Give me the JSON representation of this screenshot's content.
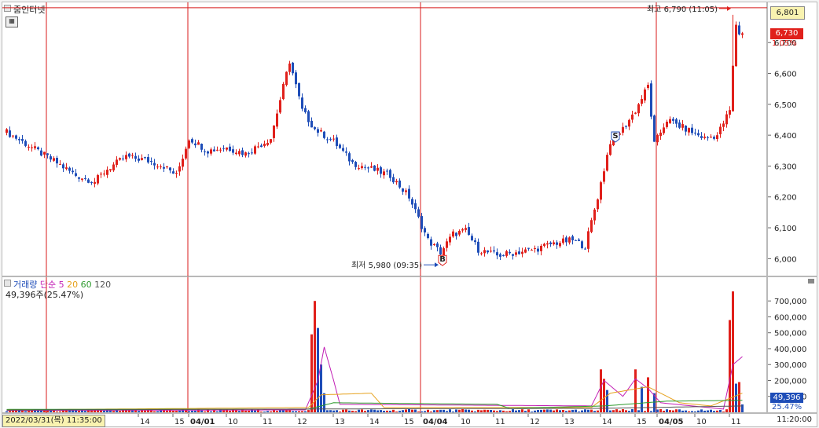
{
  "title": "줌인터넷",
  "price_current_label": "6,730",
  "price_change_label": "1.05%",
  "price_axis_top_label": "6,801",
  "price_high_annotation": "최고 6,790 (11:05)",
  "price_low_annotation": "최저 5,980 (09:35)",
  "signal_buy_label": "B",
  "signal_sell_label": "S",
  "volume_header": {
    "name": "거래량",
    "ma_label": "단순",
    "ma_periods": [
      "5",
      "20",
      "60",
      "120"
    ],
    "current_text": "49,396주(25.47%)"
  },
  "volume_current_label": "49,396",
  "volume_current_pct": "25.47%",
  "crosshair_time_label": "2022/03/31(목) 11:35:00",
  "time_axis_right_label": "11:20:00",
  "colors": {
    "up": "#e0201b",
    "down": "#1e4db8",
    "ma5": "#c21fb5",
    "ma20": "#e6a11c",
    "ma60": "#2d9a2d",
    "ma120": "#555555",
    "session_line": "#d81b1b"
  },
  "chart_data": [
    {
      "type": "candlestick",
      "title": "줌인터넷",
      "y_ticks": [
        "6,700",
        "6,600",
        "6,500",
        "6,400",
        "6,300",
        "6,200",
        "6,100",
        "6,000"
      ],
      "ylim": [
        5950,
        6810
      ],
      "x_tick_labels": [
        "14",
        "15",
        "04/01",
        "10",
        "11",
        "12",
        "13",
        "14",
        "15",
        "04/04",
        "10",
        "11",
        "12",
        "13",
        "14",
        "15",
        "04/05",
        "10",
        "11"
      ],
      "session_breaks": [
        "03/31 15:00",
        "04/01",
        "04/04",
        "04/05"
      ],
      "close_path": [
        [
          0,
          6410
        ],
        [
          8,
          6360
        ],
        [
          16,
          6310
        ],
        [
          22,
          6270
        ],
        [
          28,
          6250
        ],
        [
          32,
          6290
        ],
        [
          38,
          6330
        ],
        [
          44,
          6320
        ],
        [
          50,
          6300
        ],
        [
          54,
          6270
        ],
        [
          58,
          6390
        ],
        [
          64,
          6350
        ],
        [
          70,
          6360
        ],
        [
          76,
          6340
        ],
        [
          84,
          6390
        ],
        [
          90,
          6640
        ],
        [
          94,
          6480
        ],
        [
          98,
          6420
        ],
        [
          104,
          6380
        ],
        [
          110,
          6310
        ],
        [
          116,
          6290
        ],
        [
          122,
          6270
        ],
        [
          128,
          6200
        ],
        [
          134,
          6060
        ],
        [
          138,
          6020
        ],
        [
          142,
          6080
        ],
        [
          146,
          6090
        ],
        [
          150,
          6030
        ],
        [
          156,
          6010
        ],
        [
          162,
          6020
        ],
        [
          168,
          6030
        ],
        [
          174,
          6050
        ],
        [
          180,
          6060
        ],
        [
          184,
          6040
        ],
        [
          188,
          6200
        ],
        [
          192,
          6380
        ],
        [
          196,
          6420
        ],
        [
          200,
          6480
        ],
        [
          204,
          6560
        ],
        [
          206,
          6370
        ],
        [
          210,
          6450
        ],
        [
          216,
          6420
        ],
        [
          222,
          6390
        ],
        [
          226,
          6400
        ],
        [
          230,
          6480
        ],
        [
          232,
          6760
        ],
        [
          234,
          6700
        ]
      ],
      "high": 6790,
      "low": 5980,
      "last": 6730,
      "signals": [
        {
          "type": "B",
          "price": 5980
        },
        {
          "type": "S",
          "price": 6380
        }
      ]
    },
    {
      "type": "bar",
      "title": "거래량",
      "y_ticks": [
        "700,000",
        "600,000",
        "500,000",
        "400,000",
        "300,000",
        "200,000",
        "100,000"
      ],
      "ylim": [
        0,
        780000
      ],
      "spikes": [
        {
          "bar": 97,
          "value": 490000,
          "dir": "up"
        },
        {
          "bar": 98,
          "value": 700000,
          "dir": "up"
        },
        {
          "bar": 99,
          "value": 530000,
          "dir": "down"
        },
        {
          "bar": 100,
          "value": 300000,
          "dir": "down"
        },
        {
          "bar": 101,
          "value": 120000,
          "dir": "down"
        },
        {
          "bar": 189,
          "value": 270000,
          "dir": "up"
        },
        {
          "bar": 190,
          "value": 210000,
          "dir": "up"
        },
        {
          "bar": 191,
          "value": 140000,
          "dir": "down"
        },
        {
          "bar": 200,
          "value": 270000,
          "dir": "up"
        },
        {
          "bar": 202,
          "value": 160000,
          "dir": "down"
        },
        {
          "bar": 204,
          "value": 220000,
          "dir": "up"
        },
        {
          "bar": 206,
          "value": 120000,
          "dir": "down"
        },
        {
          "bar": 230,
          "value": 580000,
          "dir": "up"
        },
        {
          "bar": 231,
          "value": 760000,
          "dir": "up"
        },
        {
          "bar": 232,
          "value": 180000,
          "dir": "down"
        },
        {
          "bar": 233,
          "value": 190000,
          "dir": "up"
        },
        {
          "bar": 234,
          "value": 49396,
          "dir": "down"
        }
      ],
      "base_value": 10000,
      "ma5_path": [
        [
          0,
          12000
        ],
        [
          95,
          15000
        ],
        [
          99,
          200000
        ],
        [
          101,
          410000
        ],
        [
          104,
          200000
        ],
        [
          106,
          50000
        ],
        [
          186,
          40000
        ],
        [
          190,
          200000
        ],
        [
          196,
          100000
        ],
        [
          200,
          210000
        ],
        [
          204,
          150000
        ],
        [
          208,
          60000
        ],
        [
          228,
          20000
        ],
        [
          231,
          300000
        ],
        [
          234,
          350000
        ]
      ],
      "ma20_path": [
        [
          0,
          15000
        ],
        [
          96,
          30000
        ],
        [
          100,
          110000
        ],
        [
          116,
          120000
        ],
        [
          120,
          30000
        ],
        [
          186,
          30000
        ],
        [
          192,
          120000
        ],
        [
          204,
          160000
        ],
        [
          214,
          60000
        ],
        [
          224,
          40000
        ],
        [
          234,
          120000
        ]
      ],
      "ma60_path": [
        [
          0,
          18000
        ],
        [
          96,
          20000
        ],
        [
          104,
          60000
        ],
        [
          156,
          50000
        ],
        [
          160,
          25000
        ],
        [
          190,
          40000
        ],
        [
          210,
          70000
        ],
        [
          234,
          75000
        ]
      ],
      "ma120_path": [
        [
          0,
          14000
        ],
        [
          120,
          22000
        ],
        [
          190,
          25000
        ],
        [
          234,
          40000
        ]
      ]
    }
  ]
}
